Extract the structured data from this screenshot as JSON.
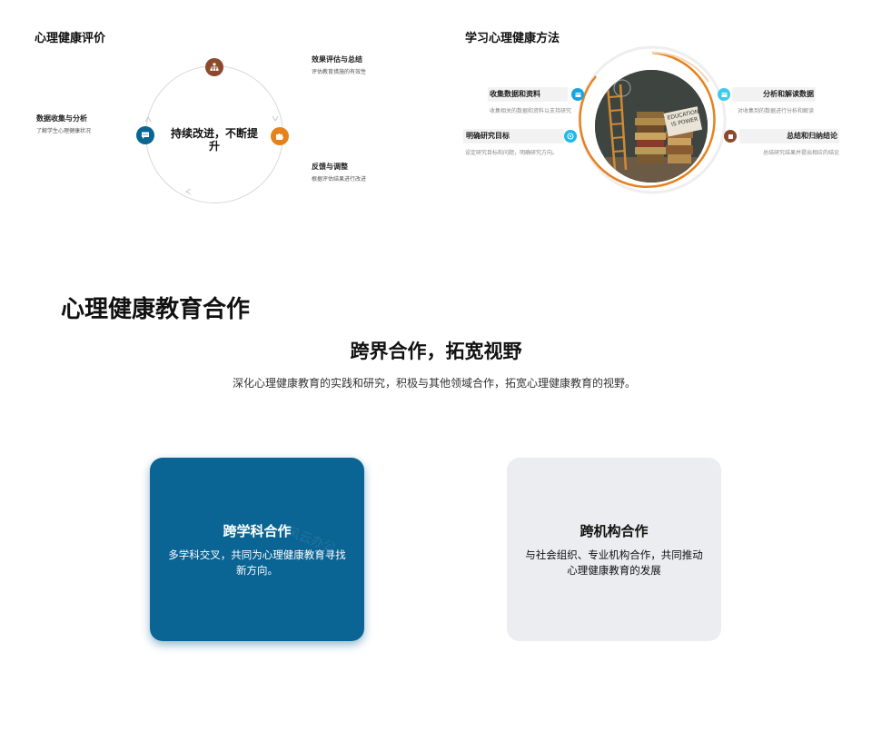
{
  "left_panel": {
    "title": "心理健康评价",
    "center": "持续改进，不断提升",
    "steps": [
      {
        "title": "效果评估与总结",
        "desc": "评估教育措施的有效性",
        "icon": "sitemap-icon",
        "color": "#8b4a2b"
      },
      {
        "title": "反馈与调整",
        "desc": "根据评估结果进行改进",
        "icon": "puzzle-icon",
        "color": "#e5821e"
      },
      {
        "title": "数据收集与分析",
        "desc": "了解学生心理健康状况",
        "icon": "chat-icon",
        "color": "#0a6494"
      }
    ]
  },
  "right_panel": {
    "title": "学习心理健康方法",
    "items": [
      {
        "title": "收集数据和资料",
        "desc": "收集相关的数据和资料以支持研究",
        "icon": "list-icon",
        "color": "#1aa3e0"
      },
      {
        "title": "明确研究目标",
        "desc": "设定研究目标和问题，明确研究方向。",
        "icon": "target-icon",
        "color": "#20b8e8"
      },
      {
        "title": "分析和解读数据",
        "desc": "对收集到的数据进行分析和解读",
        "icon": "chart-icon",
        "color": "#3fcbe8"
      },
      {
        "title": "总结和归纳结论",
        "desc": "总结研究结果并提出相应的结论",
        "icon": "book-icon",
        "color": "#8b4a2b"
      }
    ],
    "image_sign": "EDUCATION IS POWER"
  },
  "main": {
    "title": "心理健康教育合作",
    "subtitle": "跨界合作，拓宽视野",
    "description": "深化心理健康教育的实践和研究，积极与其他领域合作，拓宽心理健康教育的视野。",
    "cards": [
      {
        "title": "跨学科合作",
        "desc": "多学科交叉，共同为心理健康教育寻找新方向。",
        "watermark": "风云办公"
      },
      {
        "title": "跨机构合作",
        "desc": "与社会组织、专业机构合作，共同推动心理健康教育的发展"
      }
    ]
  }
}
